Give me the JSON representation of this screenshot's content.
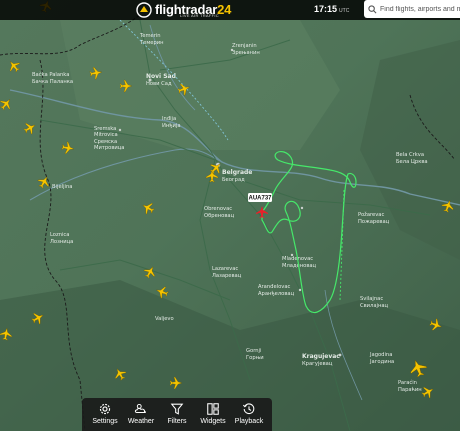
{
  "app": {
    "brand_part1": "flightradar",
    "brand_part2": "24",
    "tagline": "LIVE AIR TRAFFIC",
    "clock_time": "17:15",
    "clock_tz": "UTC"
  },
  "search": {
    "placeholder": "Find flights, airports and more"
  },
  "toolbar": {
    "settings_label": "Settings",
    "weather_label": "Weather",
    "filters_label": "Filters",
    "widgets_label": "Widgets",
    "playback_label": "Playback"
  },
  "selected_flight": {
    "callsign": "AUA737"
  },
  "map_labels": {
    "temerin": "Temerin",
    "temerin_cyr": "Темерин",
    "zrenjanin": "Zrenjanin",
    "zrenjanin_cyr": "Зрењанин",
    "backa_palanka": "Bačka Palanka",
    "backa_palanka_cyr": "Бачка Паланка",
    "novi_sad": "Novi Sad",
    "novi_sad_cyr": "Нови Сад",
    "indjija": "Inđija",
    "indjija_cyr": "Инђија",
    "sremska_mitrovica": "Sremska",
    "sremska_mitrovica2": "Mitrovica",
    "sremska_mitrovica_cyr": "Сремска",
    "sremska_mitrovica_cyr2": "Митровица",
    "belgrade": "Belgrade",
    "belgrade_cyr": "Београд",
    "obrenovac": "Obrenovac",
    "obrenovac_cyr": "Обреновац",
    "bijeljina": "Bijeljina",
    "loznica": "Loznica",
    "loznica_cyr": "Лозница",
    "bela_crkva": "Bela Crkva",
    "bela_crkva_cyr": "Бела Црква",
    "pozarevac": "Požarevac",
    "pozarevac_cyr": "Пожаревац",
    "lazarevac": "Lazarevac",
    "lazarevac_cyr": "Лазаревац",
    "mladenovac": "Mladenovac",
    "mladenovac_cyr": "Младеновац",
    "arandjelovac": "Aranđelovac",
    "arandjelovac_cyr": "Аранђеловац",
    "svilajnac": "Svilajnac",
    "svilajnac_cyr": "Свилајнац",
    "kragujevac": "Kragujevac",
    "kragujevac_cyr": "Крагујевац",
    "jagodina": "Jagodina",
    "jagodina_cyr": "Јагодина",
    "paracin": "Paraćin",
    "paracin_cyr": "Параћин",
    "valjevo": "Valjevo",
    "gornji": "Gornji",
    "gornji_cyr": "Горњи"
  },
  "colors": {
    "track": "#46e86a",
    "aircraft": "#f5c400",
    "selected_aircraft": "#e8202a",
    "callsign_bg": "#ffffff"
  }
}
